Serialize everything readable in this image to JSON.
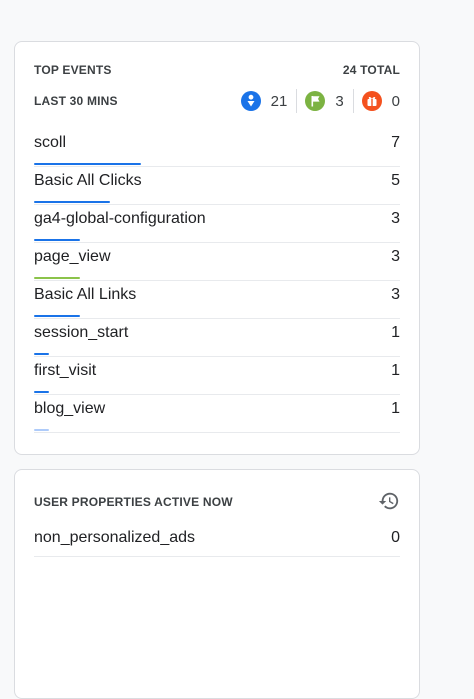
{
  "top_events": {
    "title": "TOP EVENTS",
    "total": "24 TOTAL",
    "period": "LAST 30 MINS",
    "counts": [
      {
        "icon": "person-download-icon",
        "value": "21",
        "color": "#1a73e8"
      },
      {
        "icon": "flag-icon",
        "value": "3",
        "color": "#7cb342"
      },
      {
        "icon": "gift-icon",
        "value": "0",
        "color": "#f4511e"
      }
    ],
    "max_value": 7,
    "rows": [
      {
        "name": "scoll",
        "value": "7",
        "bar_color": "#1a73e8"
      },
      {
        "name": "Basic All Clicks",
        "value": "5",
        "bar_color": "#1a73e8"
      },
      {
        "name": "ga4-global-configuration",
        "value": "3",
        "bar_color": "#1a73e8"
      },
      {
        "name": "page_view",
        "value": "3",
        "bar_color": "#8bc34a"
      },
      {
        "name": "Basic All Links",
        "value": "3",
        "bar_color": "#1a73e8"
      },
      {
        "name": "session_start",
        "value": "1",
        "bar_color": "#1a73e8"
      },
      {
        "name": "first_visit",
        "value": "1",
        "bar_color": "#1a73e8"
      },
      {
        "name": "blog_view",
        "value": "1",
        "bar_color": "#aecbfa"
      }
    ]
  },
  "user_properties": {
    "title": "USER PROPERTIES ACTIVE NOW",
    "icon": "history-icon",
    "rows": [
      {
        "name": "non_personalized_ads",
        "value": "0"
      }
    ]
  }
}
